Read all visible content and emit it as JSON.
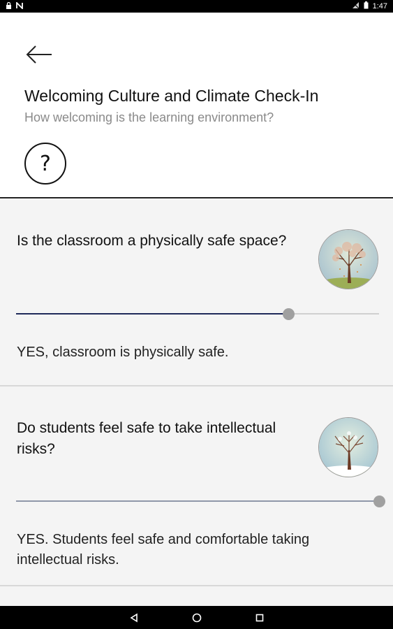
{
  "status_bar": {
    "time": "1:47"
  },
  "header": {
    "title": "Welcoming Culture and Climate Check-In",
    "subtitle": "How welcoming is the learning environment?",
    "help_label": "?"
  },
  "questions": [
    {
      "question": "Is the classroom a physically safe space?",
      "answer": "YES, classroom is physically safe.",
      "slider_value": 0.75,
      "fill_color": "#1f2a5a",
      "image_icon": "autumn-tree-icon"
    },
    {
      "question": "Do students feel safe to take intellectual risks?",
      "answer": "YES. Students feel safe and comfortable taking intellectual risks.",
      "slider_value": 1.0,
      "fill_color": "#8f97a9",
      "image_icon": "winter-tree-icon"
    }
  ],
  "colors": {
    "accent_dark": "#1f2a5a",
    "content_bg": "#f4f4f4"
  }
}
